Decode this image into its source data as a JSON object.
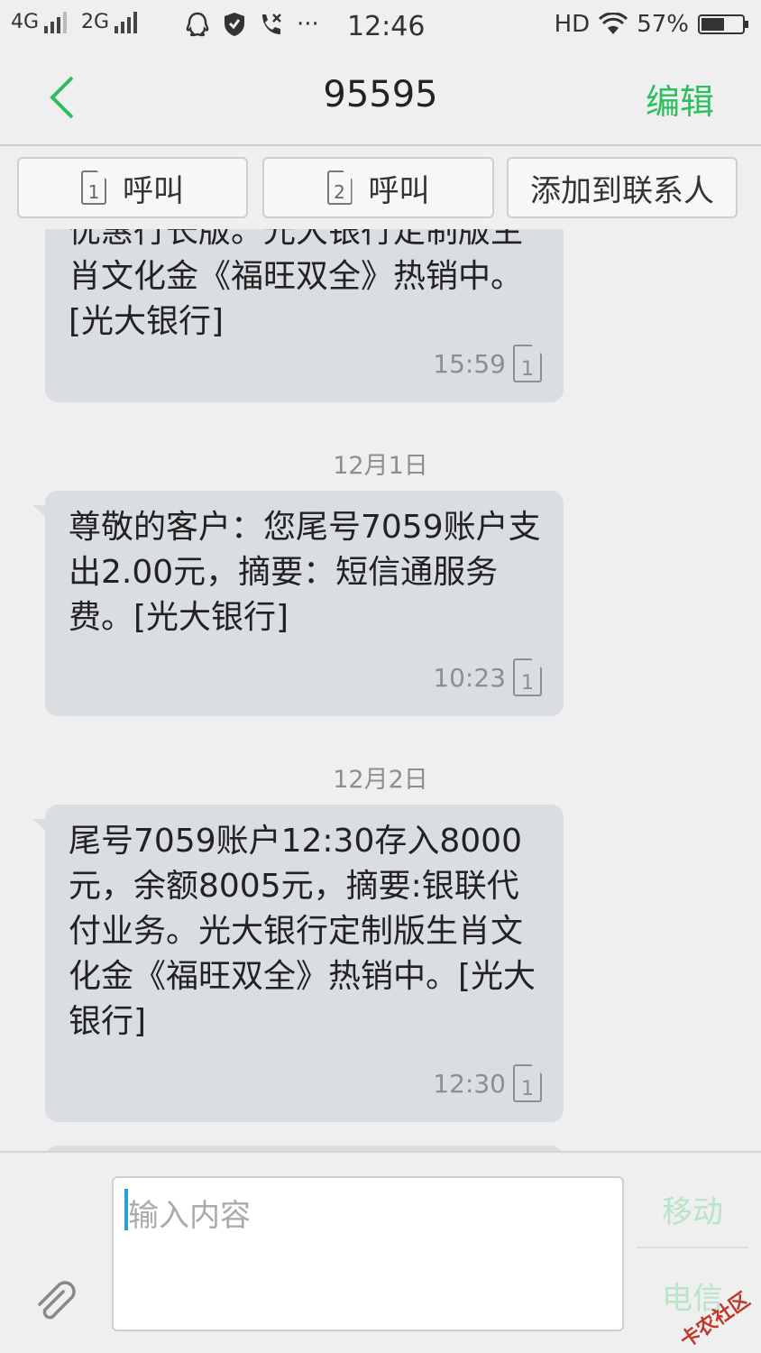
{
  "status_bar": {
    "network1": "4G",
    "network2": "2G",
    "more": "···",
    "time": "12:46",
    "hd": "HD",
    "battery": "57%",
    "battery_level": 0.57
  },
  "header": {
    "title": "95595",
    "edit_label": "编辑"
  },
  "actions": {
    "call1_label": "呼叫",
    "call1_sim": "1",
    "call2_label": "呼叫",
    "call2_sim": "2",
    "add_contact_label": "添加到联系人"
  },
  "messages": [
    {
      "text": "优惠行长版。光大银行定制版生肖文化金《福旺双全》热销中。[光大银行]",
      "time": "15:59",
      "sim": "1"
    },
    {
      "date": "12月1日",
      "text": "尊敬的客户：您尾号7059账户支出2.00元，摘要：短信通服务费。[光大银行]",
      "time": "10:23",
      "sim": "1"
    },
    {
      "date": "12月2日",
      "text": "尾号7059账户12:30存入8000元，余额8005元，摘要:银联代付业务。光大银行定制版生肖文化金《福旺双全》热销中。[光大银行]",
      "time": "12:30",
      "sim": "1"
    }
  ],
  "input": {
    "placeholder": "输入内容",
    "send_mobile": "移动",
    "send_telecom": "电信"
  },
  "watermark": "卡农社区",
  "colors": {
    "accent": "#2dbe60",
    "bubble": "#dadde1",
    "background": "#efefef"
  }
}
